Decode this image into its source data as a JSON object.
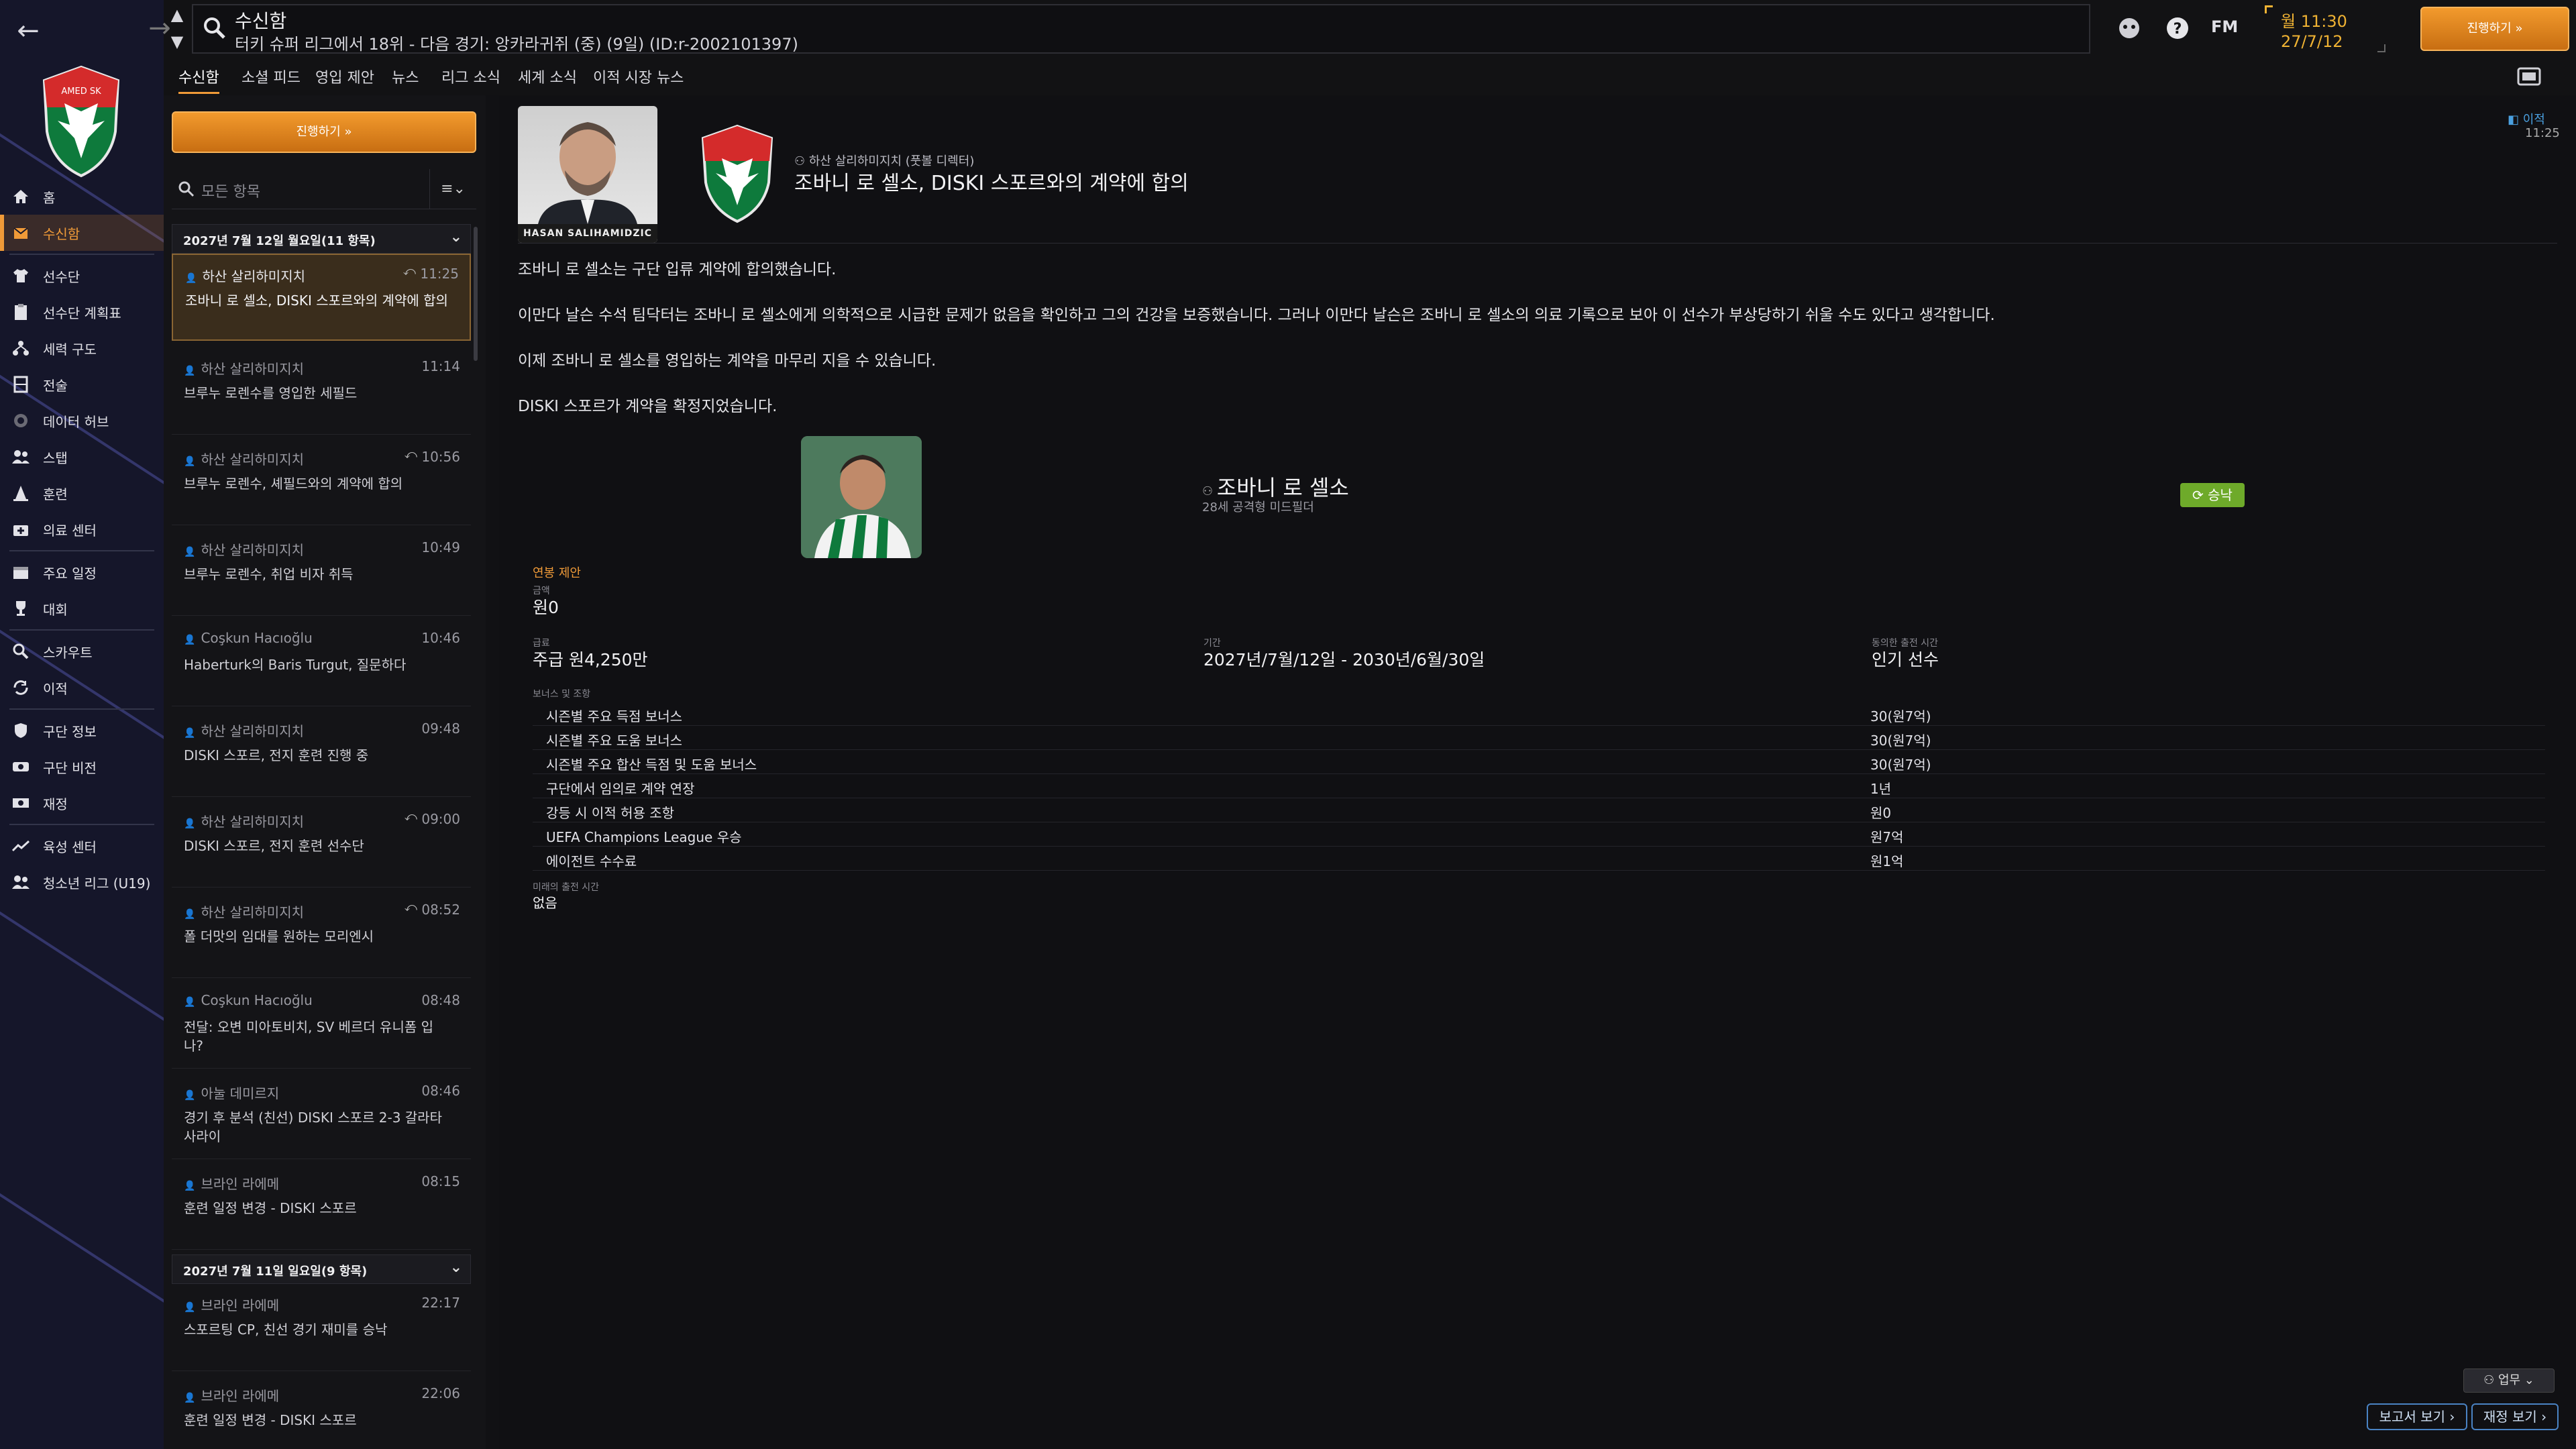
{
  "search": {
    "title": "수신함",
    "subtitle": "터키 슈퍼 리그에서 18위 - 다음 경기: 앙카라귀쥐 (중) (9일) (ID:r-2002101397)"
  },
  "topbar": {
    "fm_label": "FM",
    "clock_time": "월 11:30",
    "clock_date": "27/7/12",
    "continue_label": "진행하기"
  },
  "sidebar": {
    "items": [
      {
        "label": "홈",
        "icon": "home-icon"
      },
      {
        "label": "수신함",
        "icon": "inbox-icon",
        "active": true
      },
      {
        "label": "선수단",
        "icon": "shirt-icon"
      },
      {
        "label": "선수단 계획표",
        "icon": "clipboard-icon"
      },
      {
        "label": "세력 구도",
        "icon": "hierarchy-icon"
      },
      {
        "label": "전술",
        "icon": "tactics-icon"
      },
      {
        "label": "데이터 허브",
        "icon": "data-hub-icon"
      },
      {
        "label": "스탭",
        "icon": "staff-icon"
      },
      {
        "label": "훈련",
        "icon": "training-cone-icon"
      },
      {
        "label": "의료 센터",
        "icon": "medical-icon"
      },
      {
        "label": "주요 일정",
        "icon": "calendar-icon"
      },
      {
        "label": "대회",
        "icon": "trophy-icon"
      },
      {
        "label": "스카우트",
        "icon": "magnifier-icon"
      },
      {
        "label": "이적",
        "icon": "transfer-icon"
      },
      {
        "label": "구단 정보",
        "icon": "shield-icon"
      },
      {
        "label": "구단 비전",
        "icon": "vision-icon"
      },
      {
        "label": "재정",
        "icon": "money-icon"
      },
      {
        "label": "육성 센터",
        "icon": "growth-icon"
      },
      {
        "label": "청소년 리그 (U19)",
        "icon": "youth-icon"
      }
    ]
  },
  "tabs": [
    "수신함",
    "소셜 피드",
    "영입 제안",
    "뉴스",
    "리그 소식",
    "세계 소식",
    "이적 시장 뉴스"
  ],
  "inbox": {
    "continue_label": "진행하기",
    "filter_placeholder": "모든 항목",
    "day1": "2027년 7월 12일 월요일(11 항목)",
    "day2": "2027년 7월 11일 일요일(9 항목)",
    "messages": [
      {
        "from": "하산 살리하미지치",
        "time": "11:25",
        "subject": "조바니 로 셀소, DISKI 스포르와의 계약에 합의"
      },
      {
        "from": "하산 살리하미지치",
        "time": "11:14",
        "subject": "브루누 로렌수를 영입한 세필드"
      },
      {
        "from": "하산 살리하미지치",
        "time": "10:56",
        "subject": "브루누 로렌수, 셰필드와의 계약에 합의"
      },
      {
        "from": "하산 살리하미지치",
        "time": "10:49",
        "subject": "브루누 로렌수, 취업 비자 취득"
      },
      {
        "from": "Coşkun Hacıoğlu",
        "time": "10:46",
        "subject": "Haberturk의 Baris Turgut, 질문하다"
      },
      {
        "from": "하산 살리하미지치",
        "time": "09:48",
        "subject": "DISKI 스포르, 전지 훈련 진행 중"
      },
      {
        "from": "하산 살리하미지치",
        "time": "09:00",
        "subject": "DISKI 스포르, 전지 훈련 선수단"
      },
      {
        "from": "하산 살리하미지치",
        "time": "08:52",
        "subject": "폴 더맛의 임대를 원하는 모리엔시"
      },
      {
        "from": "Coşkun Hacıoğlu",
        "time": "08:48",
        "subject": "전달: 오변 미아토비치, SV 베르더 유니폼 입나?"
      },
      {
        "from": "아눌 데미르지",
        "time": "08:46",
        "subject": "경기 후 분석 (친선) DISKI 스포르 2-3 갈라타사라이"
      },
      {
        "from": "브라인 라에메",
        "time": "08:15",
        "subject": "훈련 일정 변경 - DISKI 스포르"
      },
      {
        "from": "브라인 라에메",
        "time": "22:17",
        "subject": "스포르팅 CP, 친선 경기 재미를 승낙"
      },
      {
        "from": "브라인 라에메",
        "time": "22:06",
        "subject": "훈련 일정 변경 - DISKI 스포르"
      }
    ]
  },
  "detail": {
    "photo_caption": "HASAN SALIHAMIDZIC",
    "sender": "하산 살리하미지치 (풋볼 디렉터)",
    "subject": "조바니 로 셀소, DISKI 스포르와의 계약에 합의",
    "tag": "이적",
    "tag_time": "11:25",
    "paragraphs": [
      "조바니 로 셀소는 구단 입류 계약에 합의했습니다.",
      "이만다 날슨 수석 팀닥터는 조바니 로 셀소에게 의학적으로 시급한 문제가 없음을 확인하고 그의 건강을 보증했습니다. 그러나 이만다 날슨은 조바니 로 셀소의 의료 기록으로 보아 이 선수가 부상당하기 쉬울 수도 있다고 생각합니다.",
      "이제 조바니 로 셀소를 영입하는 계약을 마무리 지을 수 있습니다.",
      "DISKI 스포르가 계약을 확정지었습니다."
    ],
    "player_name": "조바니 로 셀소",
    "player_desc": "28세 공격형 미드필더",
    "accepted_label": "승낙",
    "offer_title": "연봉 제안",
    "fee_label": "금액",
    "fee_value": "원0",
    "wage_label": "급료",
    "wage_value": "주급 원4,250만",
    "period_label": "기간",
    "period_value": "2027년/7월/12일 - 2030년/6월/30일",
    "status_label": "동의한 출전 시간",
    "status_value": "인기 선수",
    "bonus_title": "보너스 및 조항",
    "bonuses": [
      {
        "name": "시즌별 주요 득점 보너스",
        "value": "30(원7억)"
      },
      {
        "name": "시즌별 주요 도움 보너스",
        "value": "30(원7억)"
      },
      {
        "name": "시즌별 주요 합산 득점 및 도움 보너스",
        "value": "30(원7억)"
      },
      {
        "name": "구단에서 임의로 계약 연장",
        "value": "1년"
      },
      {
        "name": "강등 시 이적 허용 조항",
        "value": "원0"
      },
      {
        "name": "UEFA Champions League 우승",
        "value": "원7억"
      },
      {
        "name": "에이전트 수수료",
        "value": "원1억"
      }
    ],
    "min_label": "미래의 출전 시간",
    "min_value": "없음"
  },
  "bottom": {
    "work_label": "업무",
    "report_label": "보고서 보기",
    "finance_label": "재정 보기"
  },
  "colors": {
    "accent": "#ef9a38",
    "accepted": "#6eaa2a",
    "link_blue": "#4a83c4"
  }
}
